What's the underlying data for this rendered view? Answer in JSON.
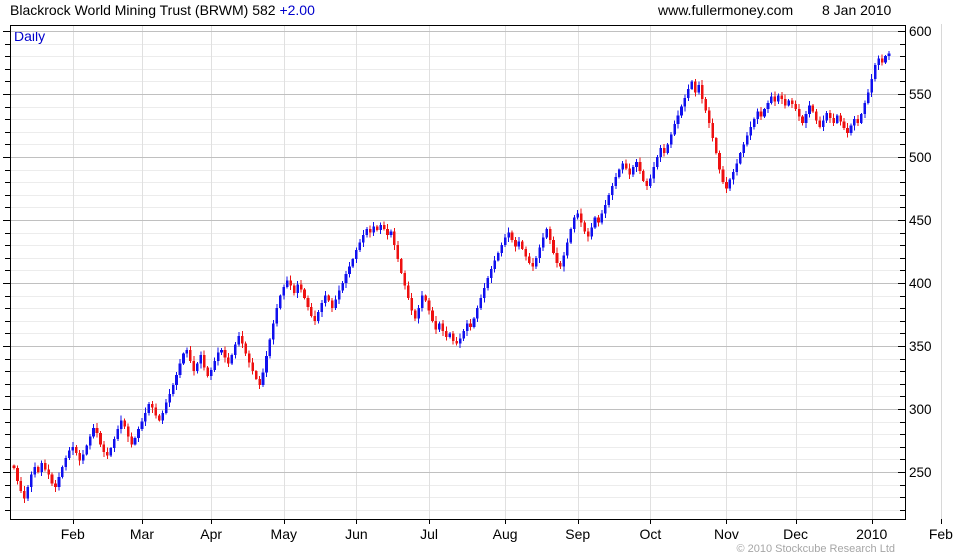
{
  "header": {
    "title": "Blackrock World Mining Trust (BRWM) 582",
    "change": "+2.00",
    "site": "www.fullermoney.com",
    "date": "8 Jan 2010"
  },
  "chart": {
    "mode_label": "Daily",
    "copyright": "© 2010 Stockcube Research Ltd"
  },
  "chart_data": {
    "type": "candlestick",
    "title": "Blackrock World Mining Trust (BRWM) daily price",
    "last_price": 582,
    "change": "+2.00",
    "up_color": "#1010ee",
    "down_color": "#ee1010",
    "grid_minor_color": "#ececec",
    "grid_major_color": "#c0c0c0",
    "grid_month_color": "#e0e0e0",
    "y_ticks": [
      250,
      300,
      350,
      400,
      450,
      500,
      550,
      600
    ],
    "y_minor_step": 10,
    "ylim": [
      213,
      605
    ],
    "x_tick_labels": [
      "Feb",
      "Mar",
      "Apr",
      "May",
      "Jun",
      "Jul",
      "Aug",
      "Sep",
      "Oct",
      "Nov",
      "Dec",
      "2010",
      "Feb"
    ],
    "month_start_days": [
      17,
      37,
      57,
      78,
      99,
      120,
      142,
      163,
      184,
      206,
      226,
      248,
      268
    ],
    "first_open": 255,
    "closes": [
      253,
      243,
      235,
      229,
      238,
      248,
      254,
      250,
      257,
      252,
      248,
      241,
      238,
      246,
      254,
      261,
      267,
      270,
      265,
      259,
      264,
      271,
      278,
      285,
      281,
      272,
      266,
      263,
      269,
      276,
      284,
      291,
      286,
      278,
      272,
      277,
      284,
      290,
      297,
      304,
      301,
      295,
      291,
      297,
      305,
      312,
      319,
      327,
      336,
      344,
      347,
      338,
      330,
      336,
      343,
      333,
      326,
      331,
      338,
      345,
      347,
      341,
      336,
      343,
      351,
      358,
      352,
      344,
      337,
      330,
      324,
      319,
      329,
      342,
      355,
      368,
      380,
      390,
      397,
      402,
      398,
      392,
      399,
      395,
      388,
      381,
      374,
      370,
      377,
      384,
      390,
      386,
      380,
      387,
      394,
      400,
      407,
      413,
      419,
      426,
      432,
      438,
      443,
      440,
      445,
      442,
      446,
      443,
      438,
      441,
      430,
      419,
      408,
      398,
      388,
      378,
      372,
      380,
      390,
      386,
      378,
      370,
      363,
      368,
      362,
      357,
      360,
      354,
      352,
      356,
      362,
      368,
      365,
      372,
      380,
      388,
      396,
      404,
      411,
      418,
      424,
      430,
      436,
      440,
      434,
      429,
      433,
      427,
      421,
      416,
      413,
      420,
      428,
      436,
      443,
      434,
      424,
      416,
      413,
      422,
      432,
      443,
      452,
      455,
      448,
      441,
      437,
      444,
      452,
      448,
      455,
      462,
      470,
      477,
      484,
      490,
      495,
      491,
      486,
      492,
      496,
      489,
      481,
      477,
      483,
      492,
      500,
      507,
      503,
      510,
      518,
      526,
      533,
      540,
      547,
      554,
      560,
      551,
      557,
      546,
      537,
      527,
      515,
      503,
      490,
      480,
      475,
      482,
      488,
      495,
      503,
      510,
      517,
      524,
      530,
      536,
      532,
      538,
      543,
      548,
      544,
      549,
      546,
      541,
      545,
      542,
      538,
      532,
      527,
      534,
      541,
      536,
      529,
      524,
      529,
      535,
      531,
      527,
      533,
      528,
      523,
      519,
      525,
      530,
      527,
      534,
      543,
      551,
      562,
      573,
      578,
      575,
      580,
      582
    ]
  }
}
